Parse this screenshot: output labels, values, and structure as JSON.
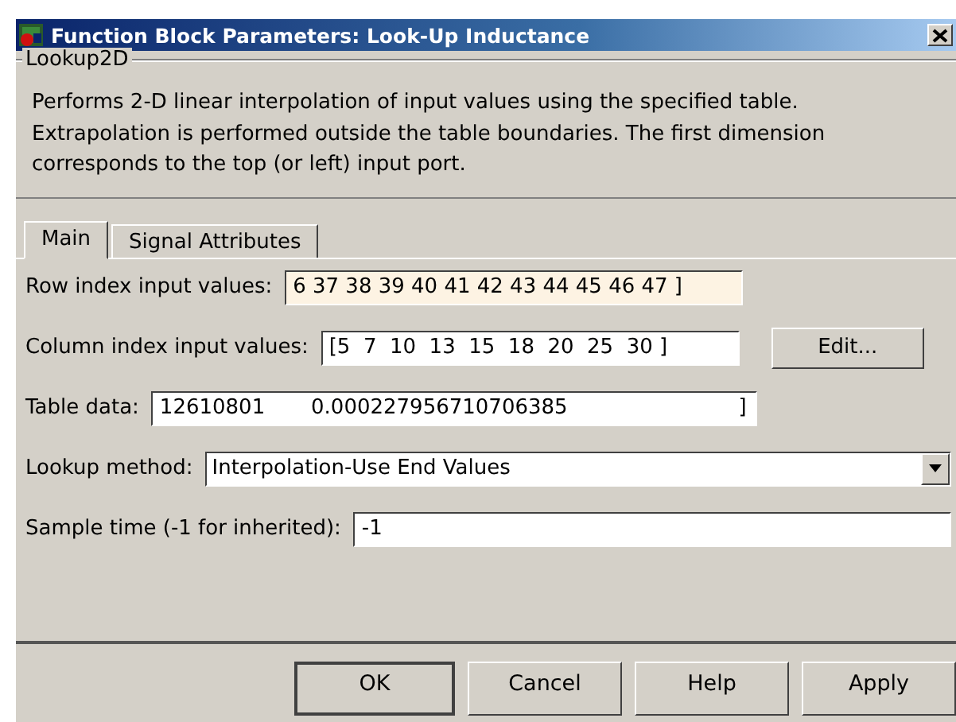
{
  "window": {
    "title": "Function Block Parameters: Look-Up Inductance"
  },
  "group": {
    "title": "Lookup2D",
    "description": "Performs 2-D linear interpolation of input values using the specified table. Extrapolation is performed outside the table boundaries.  The first dimension corresponds to the top (or left) input port."
  },
  "tabs": [
    {
      "label": "Main",
      "selected": true
    },
    {
      "label": "Signal Attributes",
      "selected": false
    }
  ],
  "parameters": [
    {
      "kind": "text",
      "label": "Row index input values:",
      "value": "6 37 38 39 40 41 42 43 44 45 46 47 ]",
      "focused": true
    },
    {
      "kind": "text_button",
      "label": "Column index input values:",
      "value": "[5  7  10  13  15  18  20  25  30 ]",
      "focused": false,
      "button": "Edit..."
    },
    {
      "kind": "text",
      "label": "Table data:",
      "value": "12610801       0.000227956710706385                          ]",
      "focused": false
    },
    {
      "kind": "dropdown",
      "label": "Lookup method:",
      "value": "Interpolation-Use End Values",
      "focused": false
    },
    {
      "kind": "text",
      "label": "Sample time (-1 for inherited):",
      "value": "-1",
      "focused": false
    }
  ],
  "buttons": [
    "OK",
    "Cancel",
    "Help",
    "Apply"
  ]
}
